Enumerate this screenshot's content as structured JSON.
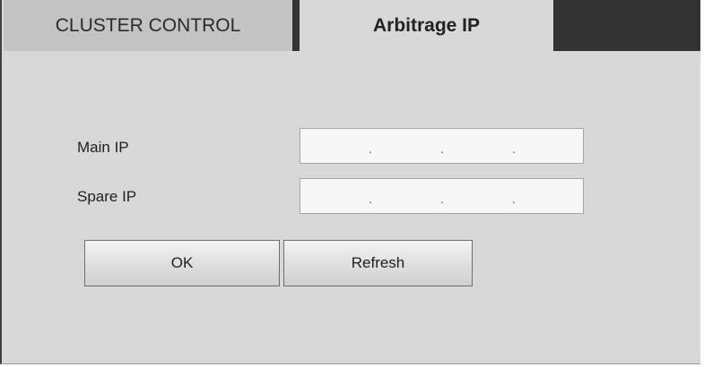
{
  "tabs": [
    {
      "label": "CLUSTER CONTROL",
      "active": false
    },
    {
      "label": "Arbitrage IP",
      "active": true
    }
  ],
  "form": {
    "main_ip_label": "Main IP",
    "main_ip_value": ". . .",
    "spare_ip_label": "Spare IP",
    "spare_ip_value": ". . .",
    "ip_separator": "."
  },
  "buttons": {
    "ok_label": "OK",
    "refresh_label": "Refresh"
  },
  "colors": {
    "background": "#d8d8d8",
    "tab_bar": "#333333",
    "inactive_tab": "#c3c3c3",
    "field_bg": "#f7f7f7"
  }
}
